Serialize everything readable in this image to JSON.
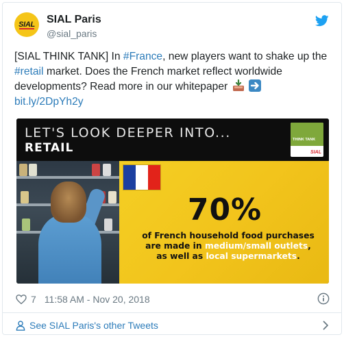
{
  "account": {
    "display_name": "SIAL Paris",
    "handle": "@sial_paris",
    "avatar_text": "SIAL"
  },
  "tweet": {
    "text_prefix": "[SIAL THINK TANK] In ",
    "hashtag_1": "#France",
    "text_mid": ", new players want to shake up the ",
    "hashtag_2": "#retail",
    "text_suffix": " market. Does the French market reflect worldwide developments? Read more in our whitepaper",
    "link": "bit.ly/2DpYh2y"
  },
  "media": {
    "banner_line1": "LET'S LOOK DEEPER INTO...",
    "banner_line2": "RETAIL",
    "badge_label": "THINK TANK",
    "badge_brand": "SIAL",
    "stat_percent": "70%",
    "stat_line1": "of French household food purchases",
    "stat_line2_pre": "are made in ",
    "stat_line2_hl": "medium/small outlets",
    "stat_line2_post": ",",
    "stat_line3_pre": "as well as ",
    "stat_line3_hl": "local supermarkets",
    "stat_line3_post": "."
  },
  "footer": {
    "like_count": "7",
    "timestamp": "11:58 AM - Nov 20, 2018",
    "other_tweets_link": "See SIAL Paris's other Tweets"
  },
  "icons": {
    "bird": "twitter-bird-icon",
    "heart": "heart-icon",
    "info": "info-icon",
    "person": "person-icon",
    "chevron": "chevron-right-icon",
    "inbox_emoji": "inbox-tray-emoji",
    "arrow_emoji": "right-arrow-emoji"
  },
  "colors": {
    "link_blue": "#2b7bb9",
    "twitter_blue": "#1da1f2",
    "meta_gray": "#697882",
    "banner_yellow": "#f2c41c",
    "flag_blue": "#1b3fa0",
    "flag_red": "#e2231a"
  }
}
